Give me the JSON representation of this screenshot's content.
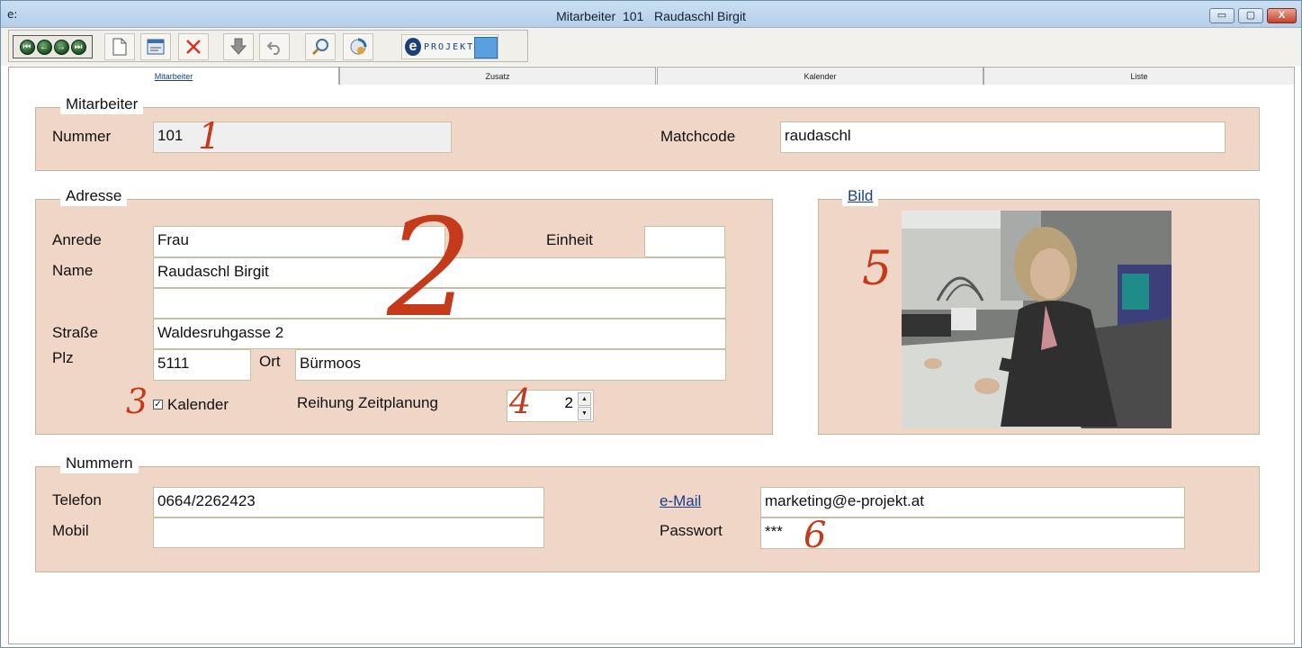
{
  "window": {
    "app_icon": "e:",
    "title": "Mitarbeiter  101   Raudaschl Birgit"
  },
  "window_controls": {
    "minimize": "▭",
    "maximize": "▢",
    "close": "X"
  },
  "toolbar": {
    "nav_icons": [
      "first-record-icon",
      "prev-record-icon",
      "next-record-icon",
      "last-record-icon"
    ],
    "buttons": [
      "new-document-icon",
      "form-view-icon",
      "delete-icon",
      "save-icon",
      "undo-icon",
      "search-icon",
      "refresh-icon"
    ],
    "brand_text": "PROJEKT:"
  },
  "tabs": [
    {
      "label": "Mitarbeiter",
      "active": true
    },
    {
      "label": "Zusatz",
      "active": false
    },
    {
      "label": "Kalender",
      "active": false
    },
    {
      "label": "Liste",
      "active": false
    }
  ],
  "mitarbeiter": {
    "legend": "Mitarbeiter",
    "nummer_label": "Nummer",
    "nummer_value": "101",
    "matchcode_label": "Matchcode",
    "matchcode_value": "raudaschl"
  },
  "adresse": {
    "legend": "Adresse",
    "anrede_label": "Anrede",
    "anrede_value": "Frau",
    "einheit_label": "Einheit",
    "einheit_value": "",
    "name_label": "Name",
    "name_value": "Raudaschl Birgit",
    "name2_value": "",
    "strasse_label": "Straße",
    "strasse_value": "Waldesruhgasse 2",
    "plz_label": "Plz",
    "plz_value": "5111",
    "ort_label": "Ort",
    "ort_value": "Bürmoos",
    "kalender_label": "Kalender",
    "kalender_checked": true,
    "reihung_label": "Reihung Zeitplanung",
    "reihung_value": "2"
  },
  "bild": {
    "legend": "Bild"
  },
  "nummern": {
    "legend": "Nummern",
    "telefon_label": "Telefon",
    "telefon_value": "0664/2262423",
    "mobil_label": "Mobil",
    "mobil_value": "",
    "email_label": "e-Mail",
    "email_value": "marketing@e-projekt.at",
    "passwort_label": "Passwort",
    "passwort_value": "***"
  },
  "annotations": [
    "1",
    "2",
    "3",
    "4",
    "5",
    "6"
  ],
  "colors": {
    "group_bg": "#efd6c7",
    "annotation": "#c43a1a",
    "link": "#1a3d8c"
  }
}
